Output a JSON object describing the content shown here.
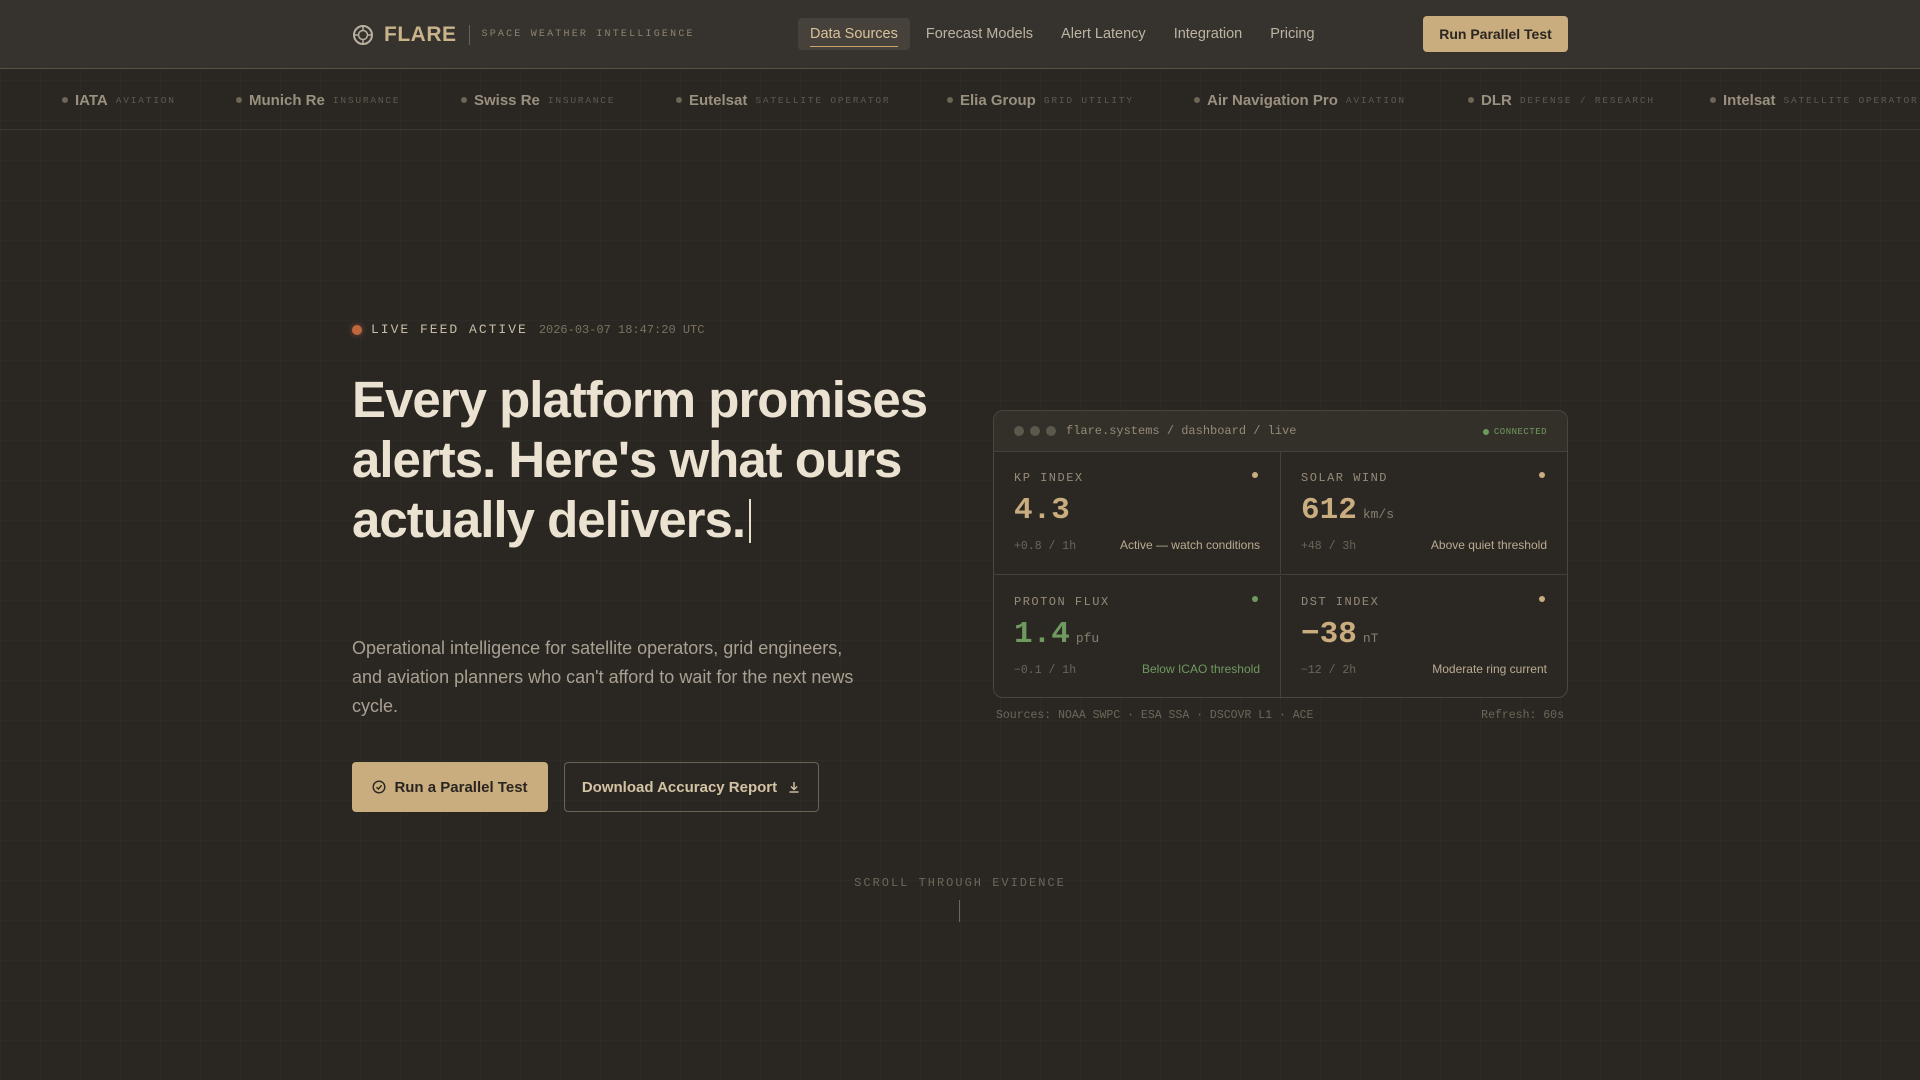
{
  "header": {
    "logo_text": "FLARE",
    "tagline": "SPACE WEATHER INTELLIGENCE",
    "nav": [
      {
        "label": "Data Sources",
        "active": true
      },
      {
        "label": "Forecast Models",
        "active": false
      },
      {
        "label": "Alert Latency",
        "active": false
      },
      {
        "label": "Integration",
        "active": false
      },
      {
        "label": "Pricing",
        "active": false
      }
    ],
    "cta_label": "Run Parallel Test"
  },
  "ticker": [
    {
      "name": "IATA",
      "category": "AVIATION"
    },
    {
      "name": "Munich Re",
      "category": "INSURANCE"
    },
    {
      "name": "Swiss Re",
      "category": "INSURANCE"
    },
    {
      "name": "Eutelsat",
      "category": "SATELLITE OPERATOR"
    },
    {
      "name": "Elia Group",
      "category": "GRID UTILITY"
    },
    {
      "name": "Air Navigation Pro",
      "category": "AVIATION"
    },
    {
      "name": "DLR",
      "category": "DEFENSE / RESEARCH"
    },
    {
      "name": "Intelsat",
      "category": "SATELLITE OPERATOR"
    }
  ],
  "hero": {
    "live_label": "LIVE FEED ACTIVE",
    "live_time": "2026-03-07 18:47:20 UTC",
    "headline": "Every platform promises alerts. Here's what ours actually delivers.",
    "subhead": "Operational intelligence for satellite operators, grid engineers, and aviation planners who can't afford to wait for the next news cycle.",
    "primary_button": "Run a Parallel Test",
    "secondary_button": "Download Accuracy Report"
  },
  "dashboard": {
    "url": "flare.systems / dashboard / live",
    "status": "CONNECTED",
    "metrics": [
      {
        "label": "KP INDEX",
        "value": "4.3",
        "unit": "",
        "change": "+0.8 / 1h",
        "note": "Active — watch conditions",
        "tone": "gold"
      },
      {
        "label": "SOLAR WIND",
        "value": "612",
        "unit": "km/s",
        "change": "+48 / 3h",
        "note": "Above quiet threshold",
        "tone": "gold"
      },
      {
        "label": "PROTON FLUX",
        "value": "1.4",
        "unit": "pfu",
        "change": "−0.1 / 1h",
        "note": "Below ICAO threshold",
        "tone": "green"
      },
      {
        "label": "DST INDEX",
        "value": "−38",
        "unit": "nT",
        "change": "−12 / 2h",
        "note": "Moderate ring current",
        "tone": "gold"
      }
    ],
    "sources": "Sources: NOAA SWPC · ESA SSA · DSCOVR L1 · ACE",
    "refresh": "Refresh: 60s"
  },
  "scroll_label": "SCROLL THROUGH EVIDENCE",
  "colors": {
    "background": "#2a2723",
    "accent_gold": "#c9ad7e",
    "status_green": "#6f9a5f",
    "live_orange": "#c0673f"
  }
}
